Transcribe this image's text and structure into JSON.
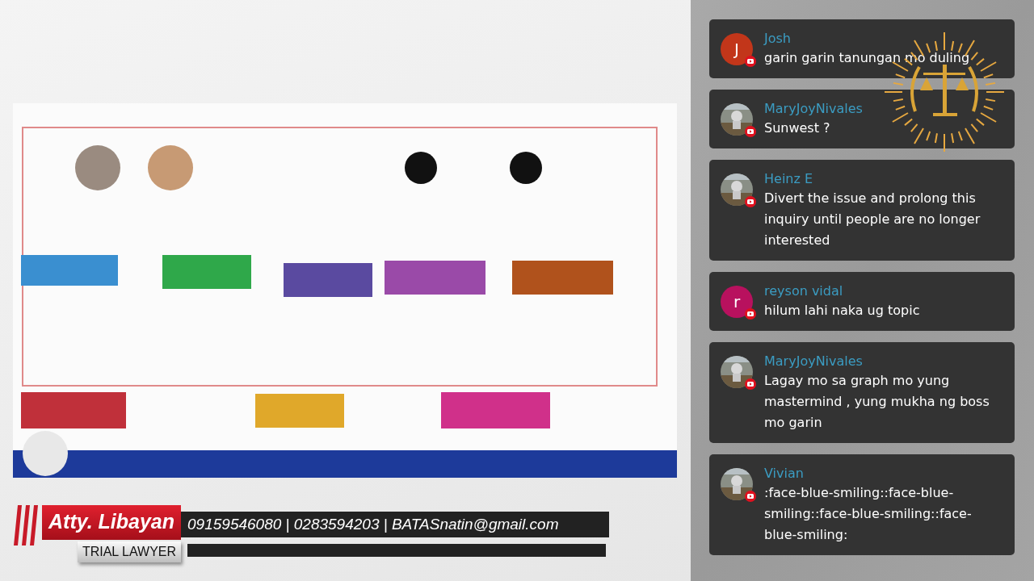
{
  "banner": {
    "name": "Atty. Libayan",
    "role": "TRIAL LAWYER",
    "contact": "09159546080 | 0283594203 | BATASnatin@gmail.com"
  },
  "chat": {
    "messages": [
      {
        "author": "Josh",
        "text": "garin garin tanungan mo duling",
        "avatar": {
          "kind": "letter",
          "initial": "J",
          "color": "#c2361a"
        }
      },
      {
        "author": "MaryJoyNivales",
        "text": "Sunwest ?"
      },
      {
        "author": "Heinz E",
        "text": "Divert the issue and prolong this inquiry until people are no longer interested"
      },
      {
        "author": "reyson vidal",
        "text": "hilum lahi naka ug topic",
        "avatar": {
          "kind": "letter",
          "initial": "r",
          "color": "#b8115e"
        }
      },
      {
        "author": "MaryJoyNivales",
        "text": "Lagay mo sa graph mo yung mastermind , yung mukha ng boss mo garin"
      },
      {
        "author": "Vivian",
        "text": ":face-blue-smiling::face-blue-smiling::face-blue-smiling::face-blue-smiling:"
      }
    ]
  }
}
